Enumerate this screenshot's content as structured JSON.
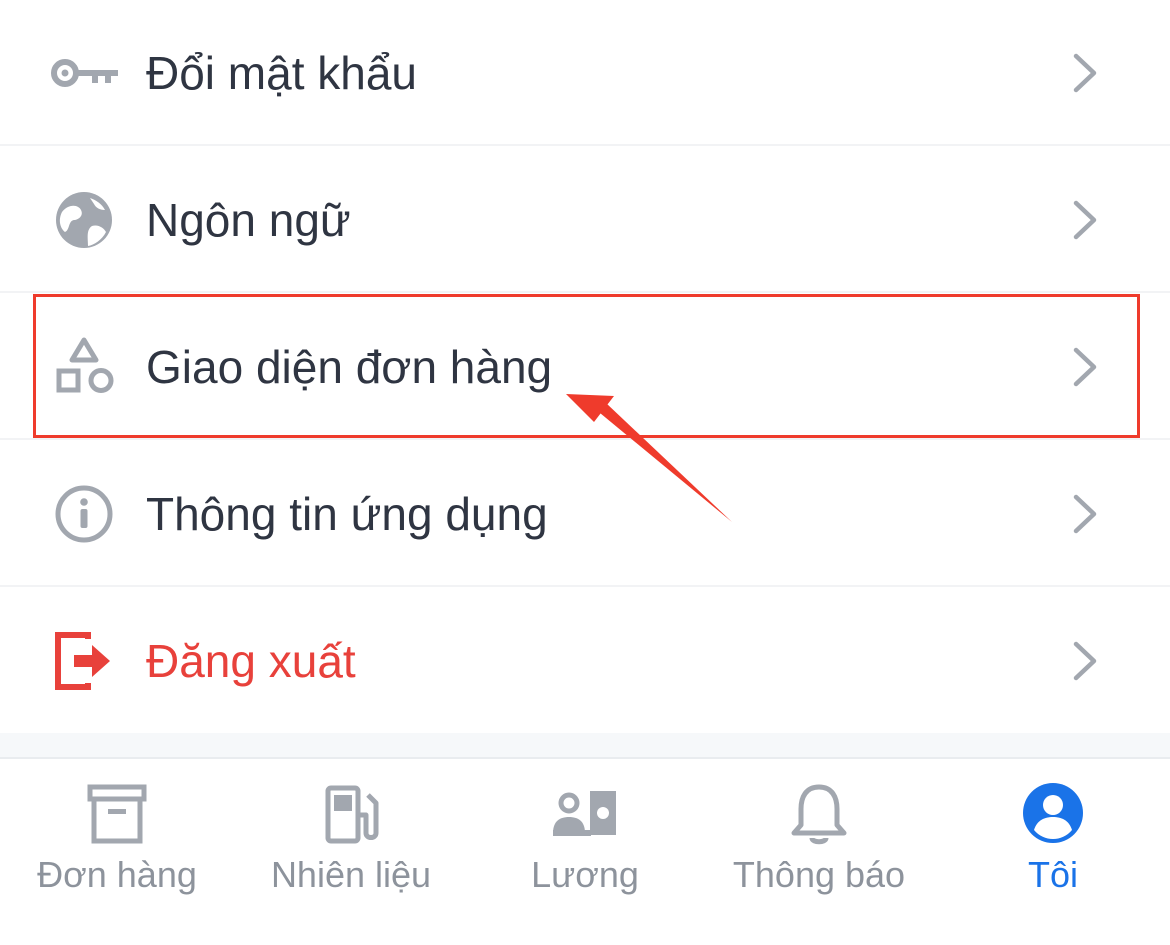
{
  "menu": {
    "items": [
      {
        "label": "Đổi mật khẩu",
        "icon": "key-icon",
        "color": "#2f3542"
      },
      {
        "label": "Ngôn ngữ",
        "icon": "globe-icon",
        "color": "#2f3542"
      },
      {
        "label": "Giao diện đơn hàng",
        "icon": "shapes-icon",
        "color": "#2f3542"
      },
      {
        "label": "Thông tin ứng dụng",
        "icon": "info-icon",
        "color": "#2f3542"
      },
      {
        "label": "Đăng xuất",
        "icon": "logout-icon",
        "color": "#e8413b"
      }
    ]
  },
  "tabbar": {
    "tabs": [
      {
        "label": "Đơn hàng",
        "icon": "archive-box-icon",
        "active": false
      },
      {
        "label": "Nhiên liệu",
        "icon": "fuel-pump-icon",
        "active": false
      },
      {
        "label": "Lương",
        "icon": "salary-icon",
        "active": false
      },
      {
        "label": "Thông báo",
        "icon": "bell-icon",
        "active": false
      },
      {
        "label": "Tôi",
        "icon": "user-avatar-icon",
        "active": true
      }
    ]
  },
  "colors": {
    "text": "#2f3542",
    "icon_gray": "#a2a7af",
    "danger": "#e8413b",
    "active_tab": "#1a73e8",
    "inactive_tab": "#8d939c",
    "annotation": "#ef3b2c"
  }
}
